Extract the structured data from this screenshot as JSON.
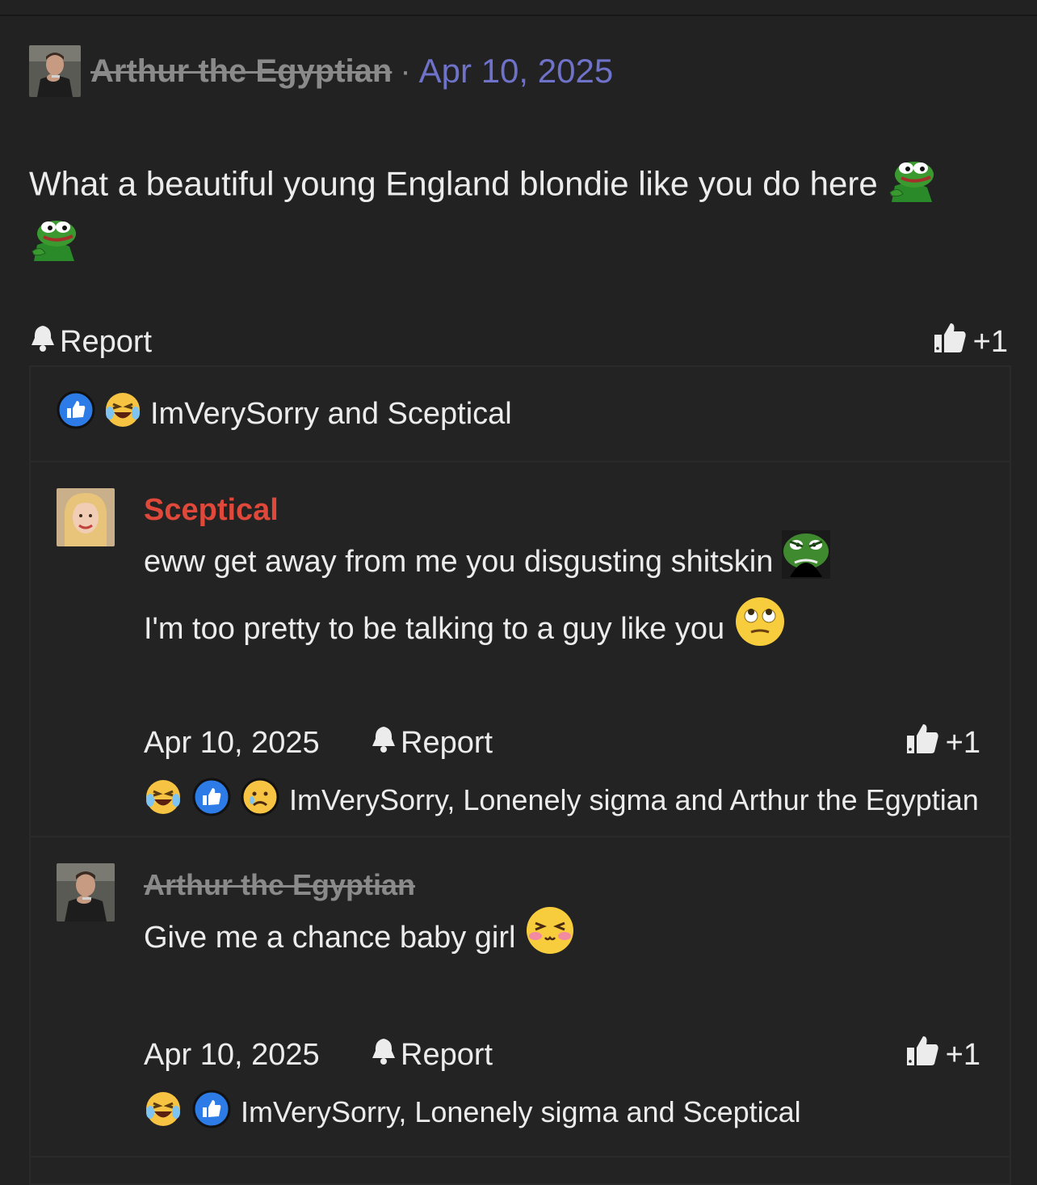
{
  "post": {
    "author": "Arthur the Egyptian",
    "separator": "·",
    "date": "Apr 10, 2025",
    "body": "What a beautiful young England blondie like you do here",
    "report_label": "Report",
    "like_count": "+1"
  },
  "reactions_summary": {
    "names": "ImVerySorry and Sceptical",
    "icons": [
      "like-icon",
      "laughing-crying-icon"
    ]
  },
  "replies": [
    {
      "author": "Sceptical",
      "lines": [
        "eww get away from me you disgusting shitskin",
        "I'm too pretty to be talking to a guy like you"
      ],
      "date": "Apr 10, 2025",
      "report_label": "Report",
      "like_count": "+1",
      "reaction_names": "ImVerySorry, Lonenely sigma and Arthur the Egyptian",
      "icons": [
        "laughing-crying-icon",
        "like-icon",
        "sad-icon"
      ]
    },
    {
      "author": "Arthur the Egyptian",
      "lines": [
        "Give me a chance baby girl"
      ],
      "date": "Apr 10, 2025",
      "report_label": "Report",
      "like_count": "+1",
      "reaction_names": "ImVerySorry, Lonenely sigma and Sceptical",
      "icons": [
        "laughing-crying-icon",
        "like-icon"
      ]
    }
  ],
  "colors": {
    "background": "#222222",
    "date_link": "#6f72c9",
    "staff_name": "#e0483a",
    "muted_name": "#8a8a8a"
  }
}
